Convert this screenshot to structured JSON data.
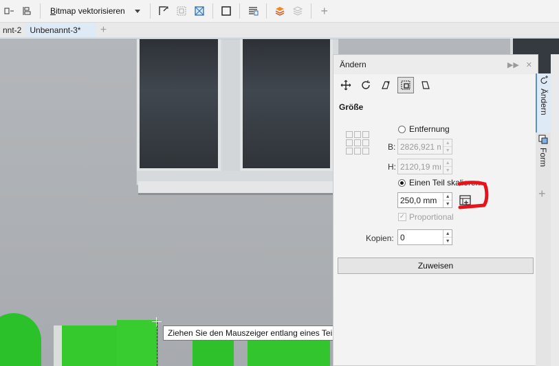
{
  "toolbar": {
    "bitmap_label": "Bitmap vektorisieren",
    "bitmap_underline": "B",
    "bitmap_rest": "itmap vektorisieren"
  },
  "doc_tabs": [
    {
      "label": "nnt-2"
    },
    {
      "label": "Unbenannt-3*"
    }
  ],
  "tooltip": "Ziehen Sie den Mauszeiger entlang eines Teils",
  "docker": {
    "title": "Ändern",
    "section": "Größe",
    "radio_distance": "Entfernung",
    "label_w": "B:",
    "value_w": "2826,921 m",
    "label_h": "H:",
    "value_h": "2120,19 mı",
    "radio_scale_part": "Einen Teil skalieren",
    "value_part": "250,0 mm",
    "proportional": "Proportional",
    "copies_label": "Kopien:",
    "copies_value": "0",
    "apply_button": "Zuweisen"
  },
  "side_tabs": [
    {
      "label": "Ändern",
      "icon": "transform-icon"
    },
    {
      "label": "Form",
      "icon": "shape-icon"
    }
  ],
  "colors": {
    "accent": "#5b8fd1",
    "annotation_red": "#e8121c",
    "letters_green": "#2bc12a"
  }
}
